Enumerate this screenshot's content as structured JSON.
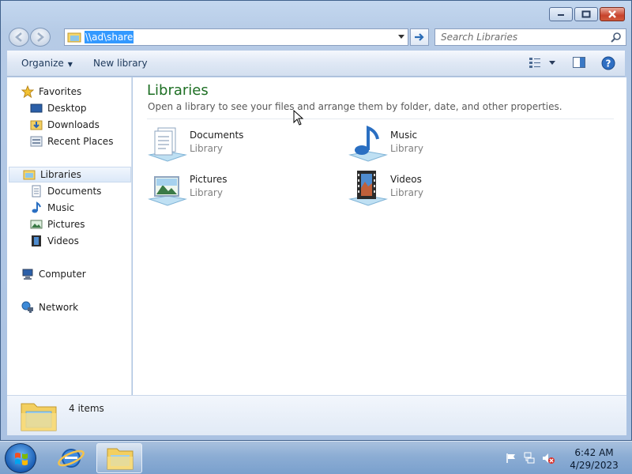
{
  "window": {
    "caption_buttons": {
      "minimize": "minimize-icon",
      "maximize": "maximize-icon",
      "close": "close-icon"
    }
  },
  "address_bar": {
    "value": "\\\\ad\\share"
  },
  "search": {
    "placeholder": "Search Libraries"
  },
  "command_bar": {
    "organize": "Organize",
    "new_library": "New library"
  },
  "nav": {
    "favorites": "Favorites",
    "favorites_items": [
      "Desktop",
      "Downloads",
      "Recent Places"
    ],
    "libraries": "Libraries",
    "libraries_items": [
      "Documents",
      "Music",
      "Pictures",
      "Videos"
    ],
    "computer": "Computer",
    "network": "Network"
  },
  "content": {
    "title": "Libraries",
    "subtitle": "Open a library to see your files and arrange them by folder, date, and other properties.",
    "items": [
      {
        "name": "Documents",
        "kind": "Library"
      },
      {
        "name": "Music",
        "kind": "Library"
      },
      {
        "name": "Pictures",
        "kind": "Library"
      },
      {
        "name": "Videos",
        "kind": "Library"
      }
    ]
  },
  "details": {
    "count": "4 items"
  },
  "taskbar": {
    "time": "6:42 AM",
    "date": "4/29/2023"
  },
  "colors": {
    "title_green": "#1e6f24",
    "selection_blue": "#3399ff",
    "close_red": "#c8432c"
  }
}
